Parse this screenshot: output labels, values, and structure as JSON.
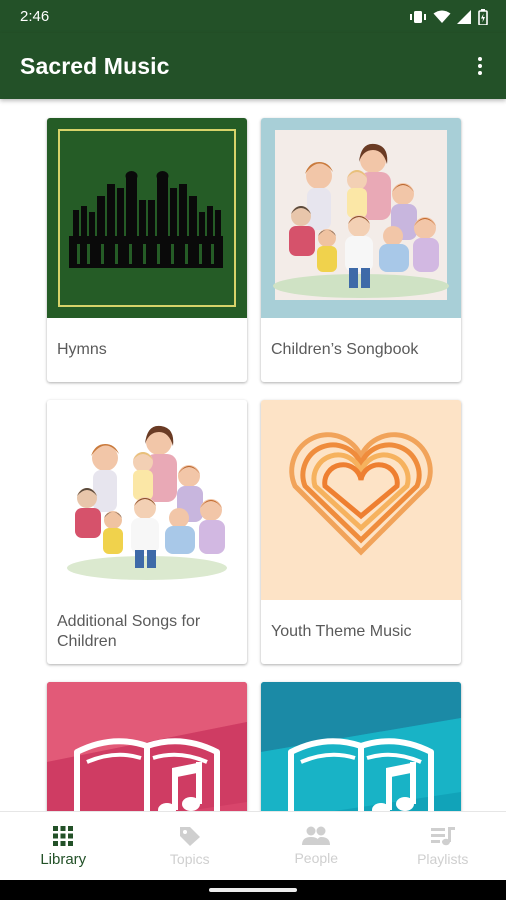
{
  "status_bar": {
    "time": "2:46",
    "icons": [
      "vibrate-icon",
      "wifi-icon",
      "signal-icon",
      "battery-icon"
    ]
  },
  "app_bar": {
    "title": "Sacred Music",
    "menu_icon": "more-vert-icon"
  },
  "library": {
    "items": [
      {
        "label": "Hymns",
        "art": "organ-pipes-art",
        "bg": "#255c26"
      },
      {
        "label": "Children’s Songbook",
        "art": "children-illustration-art",
        "bg": "#a8cfd7"
      },
      {
        "label": "Additional Songs for Children",
        "art": "children-illustration-art",
        "bg": "#ffffff"
      },
      {
        "label": "Youth Theme Music",
        "art": "heart-lines-art",
        "bg": "#fde3c6"
      },
      {
        "label": "",
        "art": "open-book-music-note-art",
        "bg": "#d8456b"
      },
      {
        "label": "",
        "art": "open-book-music-note-art",
        "bg": "#11a3b9"
      }
    ]
  },
  "bottom_nav": {
    "items": [
      {
        "label": "Library",
        "icon": "grid-icon",
        "active": true
      },
      {
        "label": "Topics",
        "icon": "tag-icon",
        "active": false
      },
      {
        "label": "People",
        "icon": "people-icon",
        "active": false
      },
      {
        "label": "Playlists",
        "icon": "playlist-icon",
        "active": false
      }
    ]
  },
  "colors": {
    "primary": "#235128",
    "inactive": "#cfcfcf"
  }
}
